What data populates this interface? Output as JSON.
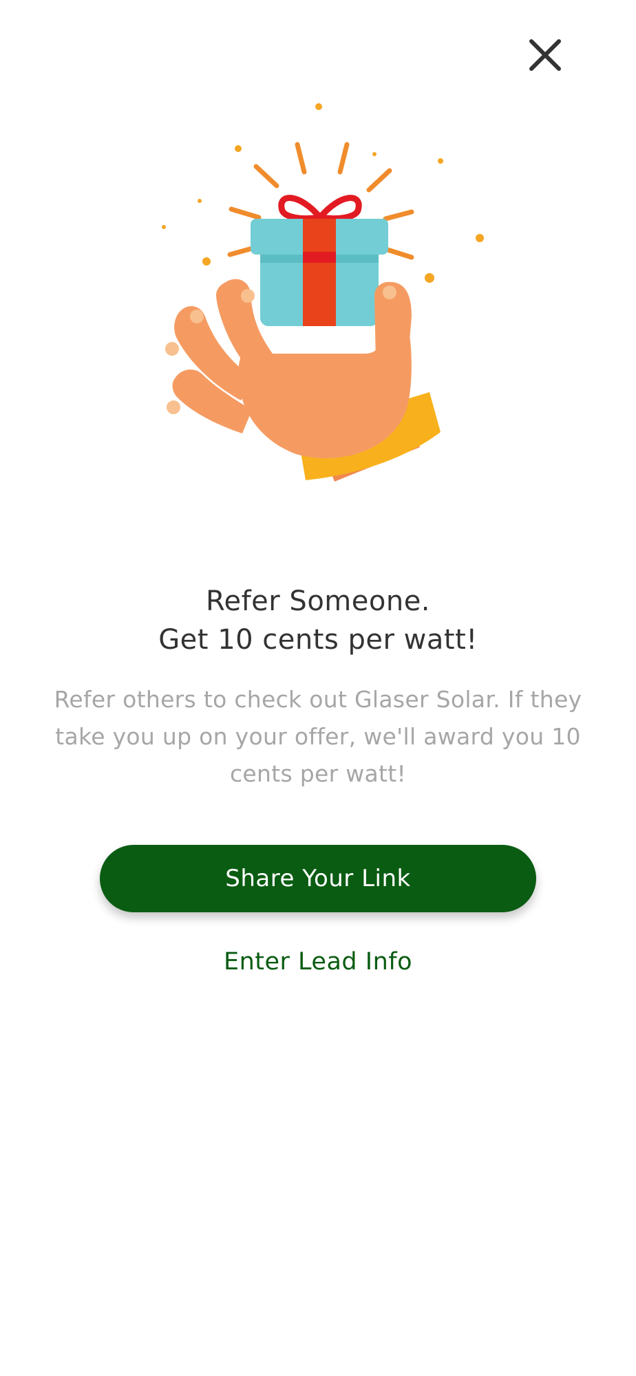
{
  "modal": {
    "close_icon": "close-icon",
    "illustration_icon": "hand-holding-gift-icon",
    "headline_line1": "Refer Someone.",
    "headline_line2": "Get 10 cents per watt!",
    "description": "Refer others to check out Glaser Solar. If they take you up on your offer, we'll award you 10 cents per watt!",
    "share_button_label": "Share Your Link",
    "enter_lead_label": "Enter Lead Info"
  },
  "colors": {
    "primary_green": "#0a5c12",
    "headline_text": "#333333",
    "description_text": "#a6a6a6"
  }
}
